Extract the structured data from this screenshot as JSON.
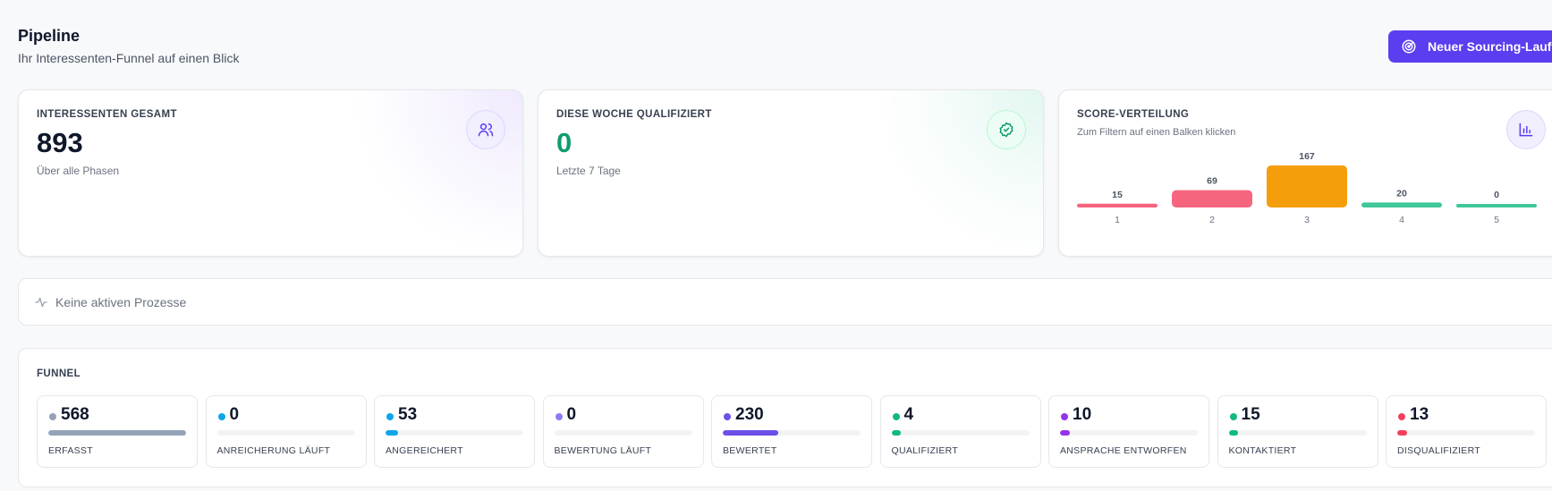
{
  "header": {
    "title": "Pipeline",
    "subtitle": "Ihr Interessenten-Funnel auf einen Blick",
    "new_run_label": "Neuer Sourcing-Lauf"
  },
  "stats": {
    "total": {
      "label": "INTERESSENTEN GESAMT",
      "value": "893",
      "sub": "Über alle Phasen",
      "icon": "users-icon"
    },
    "week": {
      "label": "DIESE WOCHE QUALIFIZIERT",
      "value": "0",
      "sub": "Letzte 7 Tage",
      "icon": "badge-check-icon"
    },
    "score": {
      "label": "SCORE-VERTEILUNG",
      "hint": "Zum Filtern auf einen Balken klicken",
      "icon": "bar-chart-icon"
    }
  },
  "chart_data": {
    "type": "bar",
    "categories": [
      "1",
      "2",
      "3",
      "4",
      "5"
    ],
    "values": [
      15,
      69,
      167,
      20,
      0
    ],
    "colors": [
      "#f43f5e",
      "#f43f5e",
      "#f59e0b",
      "#10b981",
      "#10b981"
    ],
    "title": "SCORE-VERTEILUNG"
  },
  "process": {
    "text": "Keine aktiven Prozesse",
    "icon": "activity-icon"
  },
  "funnel": {
    "title": "FUNNEL",
    "max": 568,
    "stages": [
      {
        "label": "ERFASST",
        "value": 568,
        "color": "#94a3b8"
      },
      {
        "label": "ANREICHERUNG LÄUFT",
        "value": 0,
        "color": "#0ea5e9"
      },
      {
        "label": "ANGEREICHERT",
        "value": 53,
        "color": "#0ea5e9"
      },
      {
        "label": "BEWERTUNG LÄUFT",
        "value": 0,
        "color": "#8b7cf6"
      },
      {
        "label": "BEWERTET",
        "value": 230,
        "color": "#6d4fe8"
      },
      {
        "label": "QUALIFIZIERT",
        "value": 4,
        "color": "#10b981"
      },
      {
        "label": "ANSPRACHE ENTWORFEN",
        "value": 10,
        "color": "#9333ea"
      },
      {
        "label": "KONTAKTIERT",
        "value": 15,
        "color": "#10b981"
      },
      {
        "label": "DISQUALIFIZIERT",
        "value": 13,
        "color": "#f43f5e"
      }
    ]
  }
}
